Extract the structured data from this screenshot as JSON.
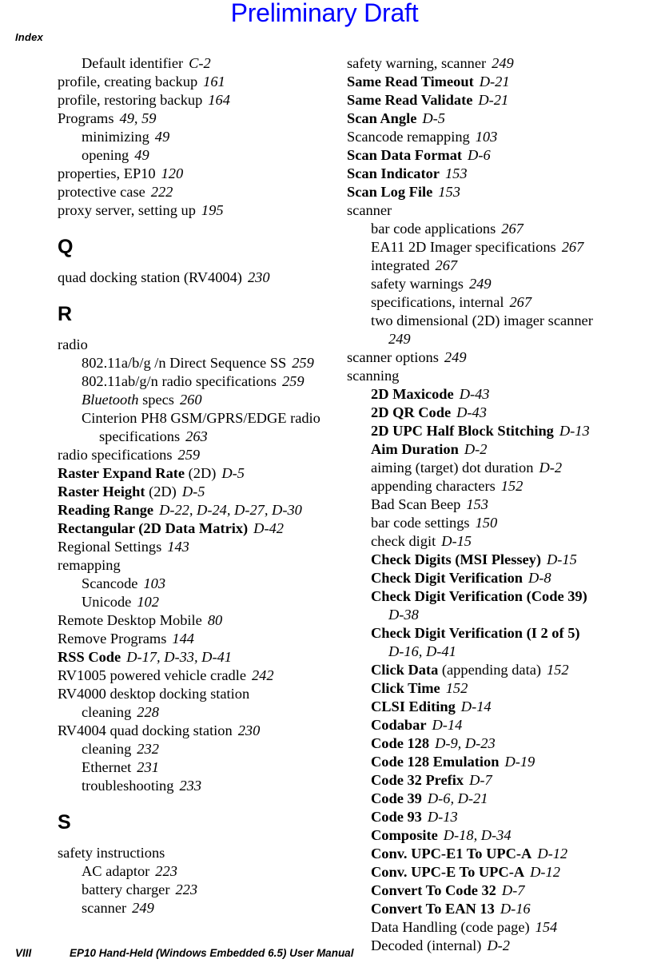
{
  "watermark": {
    "text": "Preliminary Draft",
    "color": "#0000ff"
  },
  "running_head": {
    "text": "Index"
  },
  "footer": {
    "folio": "VIII",
    "title": "EP10 Hand-Held (Windows Embedded 6.5) User Manual"
  },
  "columns": [
    {
      "id": "left",
      "blocks": [
        {
          "kind": "entry",
          "level": 1,
          "style": "plain",
          "term": "Default identifier",
          "pages": "C-2"
        },
        {
          "kind": "entry",
          "level": 0,
          "style": "plain",
          "term": "profile, creating backup",
          "pages": "161"
        },
        {
          "kind": "entry",
          "level": 0,
          "style": "plain",
          "term": "profile, restoring backup",
          "pages": "164"
        },
        {
          "kind": "entry",
          "level": 0,
          "style": "plain",
          "term": "Programs",
          "pages": "49, 59"
        },
        {
          "kind": "entry",
          "level": 1,
          "style": "plain",
          "term": "minimizing",
          "pages": "49"
        },
        {
          "kind": "entry",
          "level": 1,
          "style": "plain",
          "term": "opening",
          "pages": "49"
        },
        {
          "kind": "entry",
          "level": 0,
          "style": "plain",
          "term": "properties, EP10",
          "pages": "120"
        },
        {
          "kind": "entry",
          "level": 0,
          "style": "plain",
          "term": "protective case",
          "pages": "222"
        },
        {
          "kind": "entry",
          "level": 0,
          "style": "plain",
          "term": "proxy server, setting up",
          "pages": "195"
        },
        {
          "kind": "letter",
          "letter": "Q"
        },
        {
          "kind": "entry",
          "level": 0,
          "style": "plain",
          "term": "quad docking station (RV4004)",
          "pages": "230"
        },
        {
          "kind": "letter",
          "letter": "R"
        },
        {
          "kind": "entry",
          "level": 0,
          "style": "plain",
          "term": "radio",
          "pages": ""
        },
        {
          "kind": "entry",
          "level": 1,
          "style": "plain",
          "term": "802.11a/b/g /n Direct Sequence SS",
          "pages": "259"
        },
        {
          "kind": "entry",
          "level": 1,
          "style": "plain",
          "term": "802.11ab/g/n radio specifications",
          "pages": "259"
        },
        {
          "kind": "entry",
          "level": 1,
          "style": "italic-term",
          "term": "Bluetooth",
          "term_rest": " specs",
          "pages": "260"
        },
        {
          "kind": "entry",
          "level": 1,
          "style": "plain",
          "term": "Cinterion PH8 GSM/GPRS/EDGE radio specifications",
          "pages": "263"
        },
        {
          "kind": "entry",
          "level": 0,
          "style": "plain",
          "term": "radio specifications",
          "pages": "259"
        },
        {
          "kind": "entry",
          "level": 0,
          "style": "bold",
          "term": "Raster Expand Rate",
          "term_rest": " (2D)",
          "pages": "D-5"
        },
        {
          "kind": "entry",
          "level": 0,
          "style": "bold",
          "term": "Raster Height",
          "term_rest": " (2D)",
          "pages": "D-5"
        },
        {
          "kind": "entry",
          "level": 0,
          "style": "bold",
          "term": "Reading Range",
          "pages": "D-22, D-24, D-27, D-30"
        },
        {
          "kind": "entry",
          "level": 0,
          "style": "bold",
          "term": "Rectangular (2D Data Matrix)",
          "pages": "D-42"
        },
        {
          "kind": "entry",
          "level": 0,
          "style": "plain",
          "term": "Regional Settings",
          "pages": "143"
        },
        {
          "kind": "entry",
          "level": 0,
          "style": "plain",
          "term": "remapping",
          "pages": ""
        },
        {
          "kind": "entry",
          "level": 1,
          "style": "plain",
          "term": "Scancode",
          "pages": "103"
        },
        {
          "kind": "entry",
          "level": 1,
          "style": "plain",
          "term": "Unicode",
          "pages": "102"
        },
        {
          "kind": "entry",
          "level": 0,
          "style": "plain",
          "term": "Remote Desktop Mobile",
          "pages": "80"
        },
        {
          "kind": "entry",
          "level": 0,
          "style": "plain",
          "term": "Remove Programs",
          "pages": "144"
        },
        {
          "kind": "entry",
          "level": 0,
          "style": "bold",
          "term": "RSS Code",
          "pages": "D-17, D-33, D-41"
        },
        {
          "kind": "entry",
          "level": 0,
          "style": "plain",
          "term": "RV1005 powered vehicle cradle",
          "pages": "242"
        },
        {
          "kind": "entry",
          "level": 0,
          "style": "plain",
          "term": "RV4000 desktop docking station",
          "pages": ""
        },
        {
          "kind": "entry",
          "level": 1,
          "style": "plain",
          "term": "cleaning",
          "pages": "228"
        },
        {
          "kind": "entry",
          "level": 0,
          "style": "plain",
          "term": "RV4004 quad docking station",
          "pages": "230"
        },
        {
          "kind": "entry",
          "level": 1,
          "style": "plain",
          "term": "cleaning",
          "pages": "232"
        },
        {
          "kind": "entry",
          "level": 1,
          "style": "plain",
          "term": "Ethernet",
          "pages": "231"
        },
        {
          "kind": "entry",
          "level": 1,
          "style": "plain",
          "term": "troubleshooting",
          "pages": "233"
        },
        {
          "kind": "letter",
          "letter": "S"
        },
        {
          "kind": "entry",
          "level": 0,
          "style": "plain",
          "term": "safety instructions",
          "pages": ""
        },
        {
          "kind": "entry",
          "level": 1,
          "style": "plain",
          "term": "AC adaptor",
          "pages": "223"
        },
        {
          "kind": "entry",
          "level": 1,
          "style": "plain",
          "term": "battery charger",
          "pages": "223"
        },
        {
          "kind": "entry",
          "level": 1,
          "style": "plain",
          "term": "scanner",
          "pages": "249"
        }
      ]
    },
    {
      "id": "right",
      "blocks": [
        {
          "kind": "entry",
          "level": 0,
          "style": "plain",
          "term": "safety warning, scanner",
          "pages": "249"
        },
        {
          "kind": "entry",
          "level": 0,
          "style": "bold",
          "term": "Same Read Timeout",
          "pages": "D-21"
        },
        {
          "kind": "entry",
          "level": 0,
          "style": "bold",
          "term": "Same Read Validate",
          "pages": "D-21"
        },
        {
          "kind": "entry",
          "level": 0,
          "style": "bold",
          "term": "Scan Angle",
          "pages": "D-5"
        },
        {
          "kind": "entry",
          "level": 0,
          "style": "plain",
          "term": "Scancode remapping",
          "pages": "103"
        },
        {
          "kind": "entry",
          "level": 0,
          "style": "bold",
          "term": "Scan Data Format",
          "pages": "D-6"
        },
        {
          "kind": "entry",
          "level": 0,
          "style": "bold",
          "term": "Scan Indicator",
          "pages": "153"
        },
        {
          "kind": "entry",
          "level": 0,
          "style": "bold",
          "term": "Scan Log File",
          "pages": "153"
        },
        {
          "kind": "entry",
          "level": 0,
          "style": "plain",
          "term": "scanner",
          "pages": ""
        },
        {
          "kind": "entry",
          "level": 1,
          "style": "plain",
          "term": "bar code applications",
          "pages": "267"
        },
        {
          "kind": "entry",
          "level": 1,
          "style": "plain",
          "term": "EA11 2D Imager specifications",
          "pages": "267"
        },
        {
          "kind": "entry",
          "level": 1,
          "style": "plain",
          "term": "integrated",
          "pages": "267"
        },
        {
          "kind": "entry",
          "level": 1,
          "style": "plain",
          "term": "safety warnings",
          "pages": "249"
        },
        {
          "kind": "entry",
          "level": 1,
          "style": "plain",
          "term": "specifications, internal",
          "pages": "267"
        },
        {
          "kind": "entry",
          "level": 1,
          "style": "plain",
          "term": "two dimensional (2D) imager scanner",
          "pages": "249"
        },
        {
          "kind": "entry",
          "level": 0,
          "style": "plain",
          "term": "scanner options",
          "pages": "249"
        },
        {
          "kind": "entry",
          "level": 0,
          "style": "plain",
          "term": "scanning",
          "pages": ""
        },
        {
          "kind": "entry",
          "level": 1,
          "style": "bold",
          "term": "2D Maxicode",
          "pages": "D-43"
        },
        {
          "kind": "entry",
          "level": 1,
          "style": "bold",
          "term": "2D QR Code",
          "pages": "D-43"
        },
        {
          "kind": "entry",
          "level": 1,
          "style": "bold",
          "term": "2D UPC Half Block Stitching",
          "pages": "D-13"
        },
        {
          "kind": "entry",
          "level": 1,
          "style": "bold",
          "term": "Aim Duration",
          "pages": "D-2"
        },
        {
          "kind": "entry",
          "level": 1,
          "style": "plain",
          "term": "aiming (target) dot duration",
          "pages": "D-2"
        },
        {
          "kind": "entry",
          "level": 1,
          "style": "plain",
          "term": "appending characters",
          "pages": "152"
        },
        {
          "kind": "entry",
          "level": 1,
          "style": "plain",
          "term": "Bad Scan Beep",
          "pages": "153"
        },
        {
          "kind": "entry",
          "level": 1,
          "style": "plain",
          "term": "bar code settings",
          "pages": "150"
        },
        {
          "kind": "entry",
          "level": 1,
          "style": "plain",
          "term": "check digit",
          "pages": "D-15"
        },
        {
          "kind": "entry",
          "level": 1,
          "style": "bold",
          "term": "Check Digits (MSI Plessey)",
          "pages": "D-15"
        },
        {
          "kind": "entry",
          "level": 1,
          "style": "bold",
          "term": "Check Digit Verification",
          "pages": "D-8"
        },
        {
          "kind": "entry",
          "level": 1,
          "style": "bold",
          "term": "Check Digit Verification (Code 39)",
          "pages": "D-38"
        },
        {
          "kind": "entry",
          "level": 1,
          "style": "bold",
          "term": "Check Digit Verification (I 2 of 5)",
          "pages": "D-16, D-41"
        },
        {
          "kind": "entry",
          "level": 1,
          "style": "bold",
          "term": "Click Data",
          "term_rest": " (appending data)",
          "pages": "152"
        },
        {
          "kind": "entry",
          "level": 1,
          "style": "bold",
          "term": "Click Time",
          "pages": "152"
        },
        {
          "kind": "entry",
          "level": 1,
          "style": "bold",
          "term": "CLSI Editing",
          "pages": "D-14"
        },
        {
          "kind": "entry",
          "level": 1,
          "style": "bold",
          "term": "Codabar",
          "pages": "D-14"
        },
        {
          "kind": "entry",
          "level": 1,
          "style": "bold",
          "term": "Code 128",
          "pages": "D-9, D-23"
        },
        {
          "kind": "entry",
          "level": 1,
          "style": "bold",
          "term": "Code 128 Emulation",
          "pages": "D-19"
        },
        {
          "kind": "entry",
          "level": 1,
          "style": "bold",
          "term": "Code 32 Prefix",
          "pages": "D-7"
        },
        {
          "kind": "entry",
          "level": 1,
          "style": "bold",
          "term": "Code 39",
          "pages": "D-6, D-21"
        },
        {
          "kind": "entry",
          "level": 1,
          "style": "bold",
          "term": "Code 93",
          "pages": "D-13"
        },
        {
          "kind": "entry",
          "level": 1,
          "style": "bold",
          "term": "Composite",
          "pages": "D-18, D-34"
        },
        {
          "kind": "entry",
          "level": 1,
          "style": "bold",
          "term": "Conv. UPC-E1 To UPC-A",
          "pages": "D-12"
        },
        {
          "kind": "entry",
          "level": 1,
          "style": "bold",
          "term": "Conv. UPC-E To UPC-A",
          "pages": "D-12"
        },
        {
          "kind": "entry",
          "level": 1,
          "style": "bold",
          "term": "Convert To Code 32",
          "pages": "D-7"
        },
        {
          "kind": "entry",
          "level": 1,
          "style": "bold",
          "term": "Convert To EAN 13",
          "pages": "D-16"
        },
        {
          "kind": "entry",
          "level": 1,
          "style": "plain",
          "term": "Data Handling (code page)",
          "pages": "154"
        },
        {
          "kind": "entry",
          "level": 1,
          "style": "plain",
          "term": "Decoded (internal)",
          "pages": "D-2"
        }
      ]
    }
  ]
}
